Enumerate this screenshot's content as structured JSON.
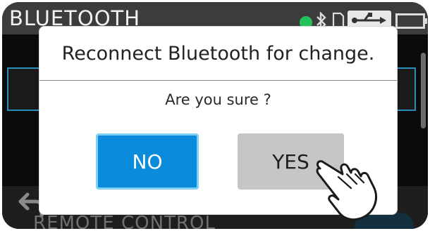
{
  "screen": {
    "title": "BLUETOOTH",
    "bottom_label": "REMOTE CONTROL"
  },
  "dialog": {
    "title": "Reconnect Bluetooth for change.",
    "message": "Are you sure ?",
    "no_label": "NO",
    "yes_label": "YES"
  },
  "icons": {
    "status": [
      "status-dot",
      "bluetooth-icon",
      "sd-card-icon",
      "usb-icon",
      "battery-icon"
    ],
    "back": "back-arrow-icon",
    "pointer": "hand-pointer-icon"
  },
  "colors": {
    "no_button": "#0a8bdc",
    "yes_button": "#c6c6c6",
    "status_dot": "#22c25a",
    "highlight_border": "#2a8fb8"
  }
}
